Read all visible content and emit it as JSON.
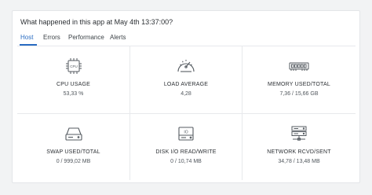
{
  "header": {
    "question": "What happened in this app at May 4th 13:37:00?"
  },
  "tabs": [
    {
      "label": "Host"
    },
    {
      "label": "Errors"
    },
    {
      "label": "Performance"
    },
    {
      "label": "Alerts"
    }
  ],
  "active_tab": "Host",
  "colors": {
    "accent": "#2a6cc2",
    "icon_stroke": "#555b61"
  },
  "metrics": [
    {
      "label": "CPU USAGE",
      "value": "53,33 %",
      "icon": "cpu-icon"
    },
    {
      "label": "LOAD AVERAGE",
      "value": "4,28",
      "icon": "gauge-icon"
    },
    {
      "label": "MEMORY USED/TOTAL",
      "value": "7,36 / 15,66 GB",
      "icon": "memory-icon"
    },
    {
      "label": "SWAP USED/TOTAL",
      "value": "0 / 999,02 MB",
      "icon": "drive-icon"
    },
    {
      "label": "DISK I/O READ/WRITE",
      "value": "0 / 10,74 MB",
      "icon": "disk-io-icon"
    },
    {
      "label": "NETWORK RCVD/SENT",
      "value": "34,78 / 13,48 MB",
      "icon": "server-icon"
    }
  ],
  "icon_text": {
    "cpu": "CPU",
    "disk_io": "IO"
  }
}
